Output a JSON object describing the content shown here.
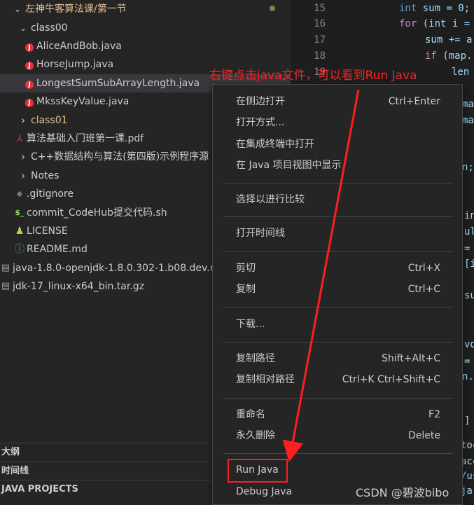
{
  "explorer": {
    "items": [
      {
        "label": "左神牛客算法课/第一节",
        "type": "folder-open",
        "modified": true
      },
      {
        "label": "class00",
        "type": "folder-open"
      },
      {
        "label": "AliceAndBob.java",
        "type": "java"
      },
      {
        "label": "HorseJump.java",
        "type": "java"
      },
      {
        "label": "LongestSumSubArrayLength.java",
        "type": "java",
        "selected": true
      },
      {
        "label": "MkssKeyValue.java",
        "type": "java"
      },
      {
        "label": "class01",
        "type": "folder-closed"
      },
      {
        "label": "算法基础入门班第一课.pdf",
        "type": "pdf"
      },
      {
        "label": "C++数据结构与算法(第四版)示例程序源",
        "type": "folder-closed"
      },
      {
        "label": "Notes",
        "type": "folder-closed"
      },
      {
        "label": ".gitignore",
        "type": "gitignore"
      },
      {
        "label": "commit_CodeHub提交代码.sh",
        "type": "shell"
      },
      {
        "label": "LICENSE",
        "type": "license"
      },
      {
        "label": "README.md",
        "type": "readme"
      },
      {
        "label": "java-1.8.0-openjdk-1.8.0.302-1.b08.dev.red",
        "type": "archive"
      },
      {
        "label": "jdk-17_linux-x64_bin.tar.gz",
        "type": "archive"
      }
    ],
    "sections": [
      "大纲",
      "时间线",
      "JAVA PROJECTS"
    ]
  },
  "editor": {
    "line_numbers": [
      "15",
      "16",
      "17",
      "18",
      "19"
    ],
    "lines": [
      {
        "kw": "int",
        "rest": " sum = 0;"
      },
      {
        "kw": "for",
        "rest": " (int i = "
      },
      {
        "kw": "",
        "rest": "sum += a"
      },
      {
        "kw": "if",
        "rest": " (map."
      },
      {
        "kw": "",
        "rest": "len"
      }
    ],
    "fragments": [
      "map",
      "map.",
      "n;",
      "in",
      "ult",
      "=",
      "[i",
      "sul",
      "vo",
      "=",
      "n.c",
      "]",
      "toc",
      "ac4",
      "/us",
      "ja"
    ]
  },
  "context_menu": {
    "groups": [
      [
        {
          "label": "在侧边打开",
          "shortcut": "Ctrl+Enter"
        },
        {
          "label": "打开方式...",
          "shortcut": ""
        },
        {
          "label": "在集成终端中打开",
          "shortcut": ""
        },
        {
          "label": "在 Java 项目视图中显示",
          "shortcut": ""
        }
      ],
      [
        {
          "label": "选择以进行比较",
          "shortcut": ""
        }
      ],
      [
        {
          "label": "打开时间线",
          "shortcut": ""
        }
      ],
      [
        {
          "label": "剪切",
          "shortcut": "Ctrl+X"
        },
        {
          "label": "复制",
          "shortcut": "Ctrl+C"
        }
      ],
      [
        {
          "label": "下载...",
          "shortcut": ""
        }
      ],
      [
        {
          "label": "复制路径",
          "shortcut": "Shift+Alt+C"
        },
        {
          "label": "复制相对路径",
          "shortcut": "Ctrl+K Ctrl+Shift+C"
        }
      ],
      [
        {
          "label": "重命名",
          "shortcut": "F2"
        },
        {
          "label": "永久删除",
          "shortcut": "Delete"
        }
      ],
      [
        {
          "label": "Run Java",
          "shortcut": "",
          "highlighted": true
        },
        {
          "label": "Debug Java",
          "shortcut": ""
        }
      ]
    ]
  },
  "annotation": {
    "text": "右键点击java文件，可以看到Run Java",
    "color": "#ff2020"
  },
  "watermark": "CSDN @碧波bibo",
  "colors": {
    "sidebar_bg": "#252526",
    "editor_bg": "#1e1e1e",
    "menu_border": "#454545",
    "highlight_red": "#ff1e1e",
    "java_icon": "#e0333a",
    "folder_label": "#e2c08d"
  }
}
